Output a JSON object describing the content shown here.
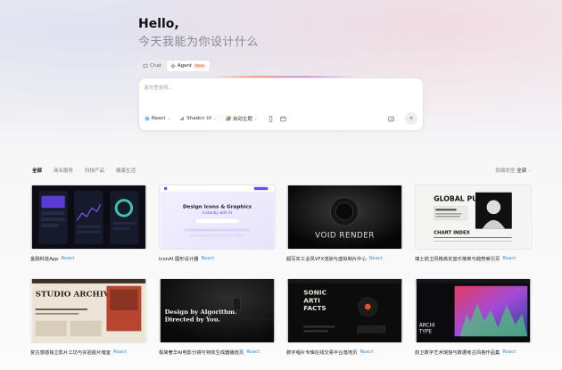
{
  "hero": {
    "greeting": "Hello,",
    "subtitle": "今天我能为你设计什么"
  },
  "mode_switch": {
    "chat_label": "Chat",
    "agent_label": "Agent",
    "new_badge": "New"
  },
  "prompt": {
    "placeholder": "请先登录哦...",
    "value": ""
  },
  "toolbar": {
    "framework": "React",
    "ui_library": "Shadcn UI",
    "theme": "自动主题"
  },
  "filters": {
    "tabs": [
      {
        "label": "全部",
        "active": true
      },
      {
        "label": "商业服务",
        "active": false
      },
      {
        "label": "科技产品",
        "active": false
      },
      {
        "label": "健康生活",
        "active": false
      }
    ],
    "sort_label": "按编类型",
    "sort_value": "全部"
  },
  "cards": [
    {
      "title": "金融科技App",
      "tag": "React",
      "thumb_text": ""
    },
    {
      "title": "IconAI 图形设计器",
      "tag": "React",
      "thumb_text": "Design Icons & Graphics",
      "thumb_sub": "Instantly with AI"
    },
    {
      "title": "超写实工业风VFX渲染与虚拟制片中心",
      "tag": "React",
      "thumb_text": "VOID RENDER"
    },
    {
      "title": "瑞士前卫风格高定音乐榜单与趋势索引页",
      "tag": "React",
      "thumb_text": "GLOBAL PULSE",
      "thumb_sub": "CHART INDEX"
    },
    {
      "title": "复古感感独立影片工坊与实验胶片暗室",
      "tag": "React",
      "thumb_text": "STUDIO ARCHIVE"
    },
    {
      "title": "极简奢华AI电影分镜与特效生成器播放页",
      "tag": "React",
      "thumb_text": "Design by Algorithm. Directed by You."
    },
    {
      "title": "数字唱片专辑在线交易平台落地页",
      "tag": "React",
      "thumb_text": "SONIC ARTI FACTS"
    },
    {
      "title": "前卫数字艺术馆馆与数据考古风格作品集",
      "tag": "React",
      "thumb_text": "ARCHI TYPE"
    }
  ],
  "colors": {
    "accent_tag": "#2b8fd9",
    "badge_text": "#e35a2a",
    "badge_bg": "#fde3d8"
  }
}
